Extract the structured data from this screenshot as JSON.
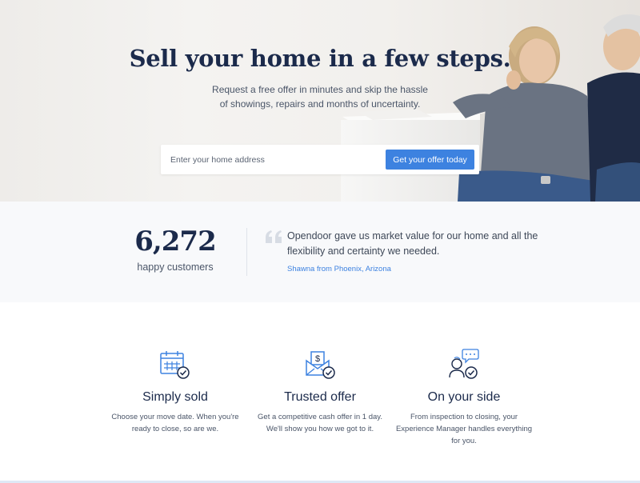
{
  "hero": {
    "title": "Sell your home in a few steps.",
    "subtitle_line1": "Request a free offer in minutes and skip the hassle",
    "subtitle_line2": "of showings, repairs and months of uncertainty.",
    "address_placeholder": "Enter your home address",
    "cta_label": "Get your offer today"
  },
  "stats": {
    "customer_count": "6,272",
    "customer_label": "happy customers",
    "quote_line1": "Opendoor gave us market value for our home and all the",
    "quote_line2": "flexibility and certainty we needed.",
    "quote_author": "Shawna from Phoenix, Arizona"
  },
  "features": [
    {
      "icon": "calendar-check-icon",
      "title": "Simply sold",
      "desc_line1": "Choose your move date. When you're",
      "desc_line2": "ready to close, so are we.",
      "desc_line3": ""
    },
    {
      "icon": "envelope-dollar-check-icon",
      "title": "Trusted offer",
      "desc_line1": "Get a competitive cash offer in 1 day.",
      "desc_line2": "We'll show you how we got to it.",
      "desc_line3": ""
    },
    {
      "icon": "person-chat-check-icon",
      "title": "On your side",
      "desc_line1": "From inspection to closing, your",
      "desc_line2": "Experience Manager handles everything",
      "desc_line3": "for you."
    }
  ],
  "colors": {
    "accent": "#3d82e0",
    "navy": "#1b2a4b",
    "body_text": "#4a5568",
    "stats_bg": "#f8f9fb"
  }
}
